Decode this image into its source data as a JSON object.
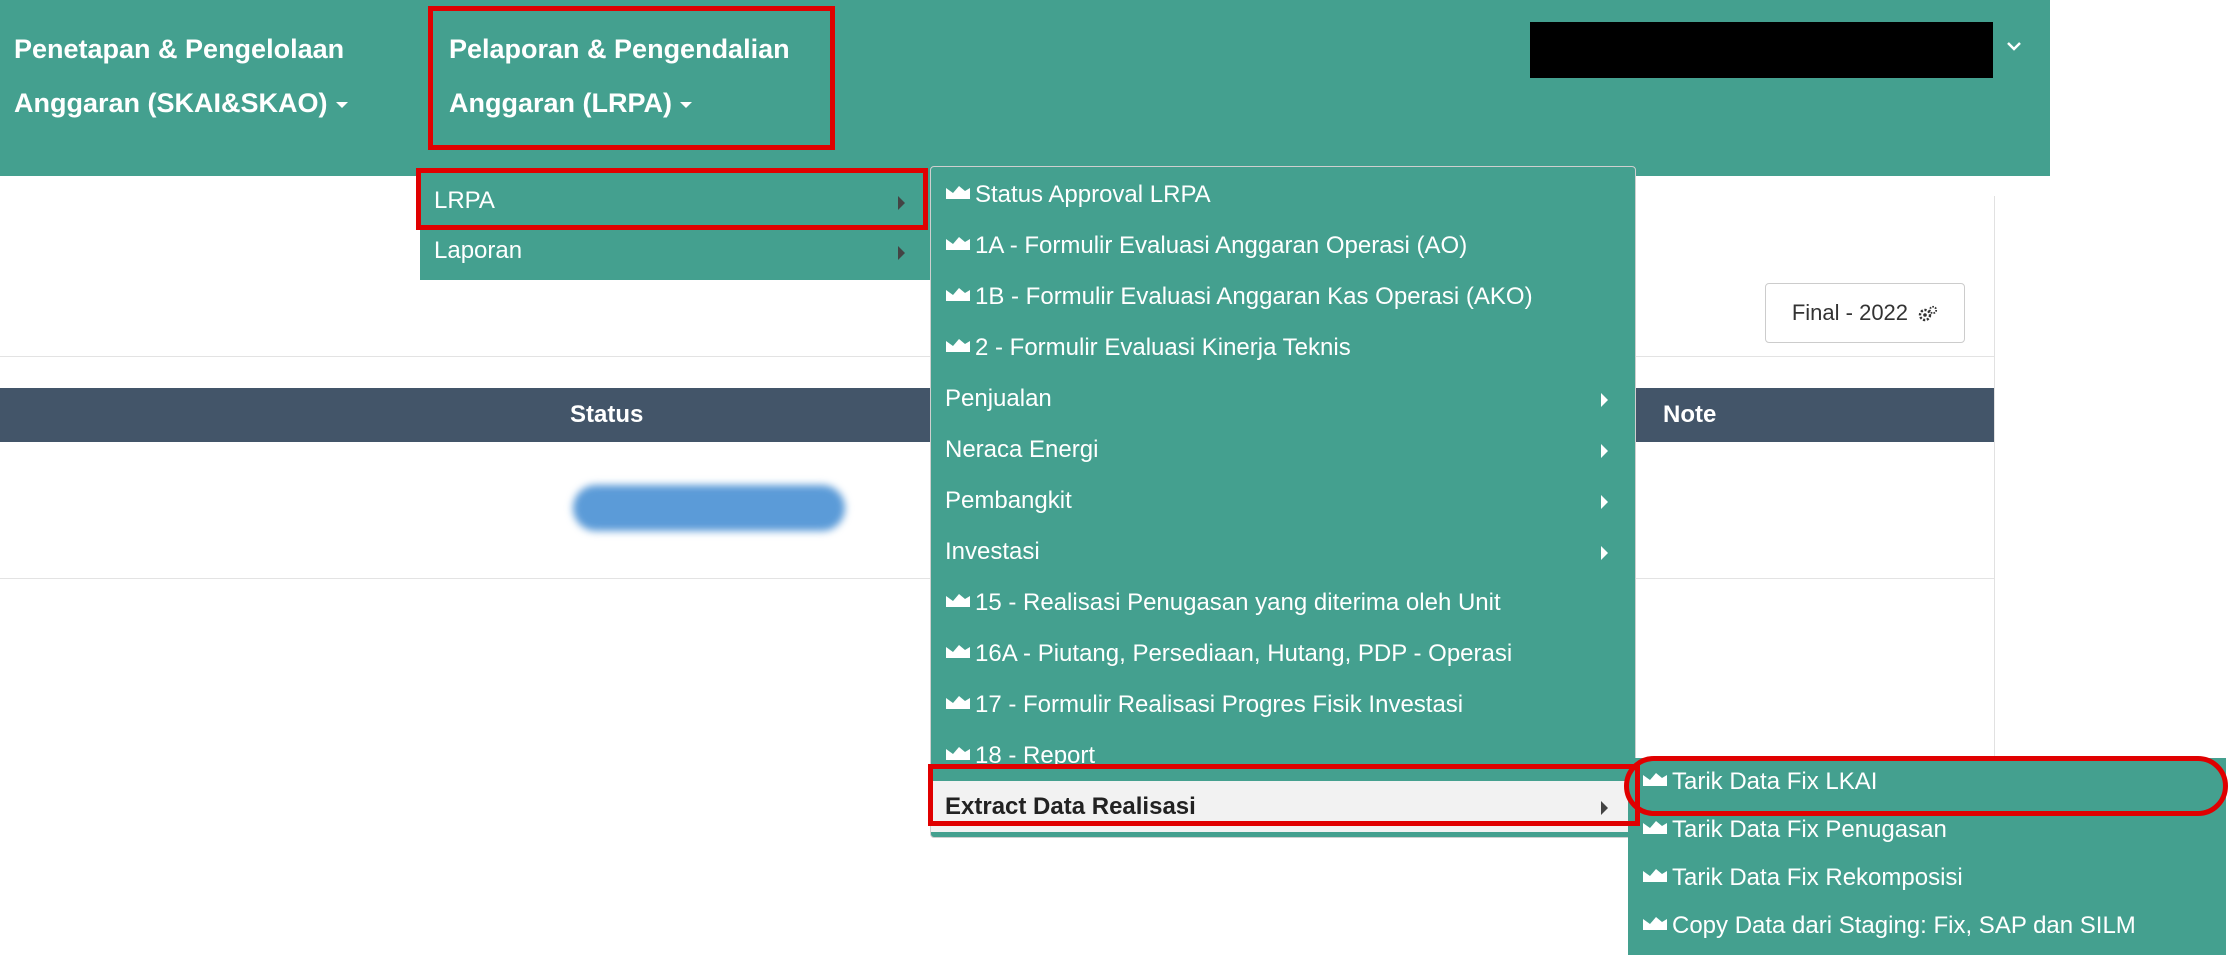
{
  "nav": {
    "menu1": {
      "line1": "Penetapan & Pengelolaan",
      "line2": "Anggaran (SKAI&SKAO)"
    },
    "menu2": {
      "line1": "Pelaporan & Pengendalian",
      "line2": "Anggaran (LRPA)"
    }
  },
  "content": {
    "final_button": "Final - 2022",
    "table_headers": {
      "status": "Status",
      "note": "Note"
    }
  },
  "menu_lrpa": {
    "items": [
      {
        "label": "LRPA"
      },
      {
        "label": "Laporan"
      }
    ]
  },
  "menu_sub": {
    "items": [
      {
        "label": "Status Approval LRPA",
        "icon": "chart-area-icon"
      },
      {
        "label": "1A - Formulir Evaluasi Anggaran Operasi (AO)",
        "icon": "chart-area-icon"
      },
      {
        "label": "1B - Formulir Evaluasi Anggaran Kas Operasi (AKO)",
        "icon": "chart-area-icon"
      },
      {
        "label": "2 - Formulir Evaluasi Kinerja Teknis",
        "icon": "chart-area-icon"
      },
      {
        "label": "Penjualan"
      },
      {
        "label": "Neraca Energi"
      },
      {
        "label": "Pembangkit"
      },
      {
        "label": "Investasi"
      },
      {
        "label": "15 - Realisasi Penugasan yang diterima oleh Unit",
        "icon": "chart-area-icon"
      },
      {
        "label": "16A - Piutang, Persediaan, Hutang, PDP - Operasi",
        "icon": "chart-area-icon"
      },
      {
        "label": "17 - Formulir Realisasi Progres Fisik Investasi",
        "icon": "chart-area-icon"
      },
      {
        "label": "18 - Report",
        "icon": "chart-area-icon"
      },
      {
        "label": "Extract Data Realisasi"
      }
    ]
  },
  "menu_extract": {
    "items": [
      {
        "label": "Tarik Data Fix LKAI",
        "icon": "chart-area-icon"
      },
      {
        "label": "Tarik Data Fix Penugasan",
        "icon": "chart-area-icon"
      },
      {
        "label": "Tarik Data Fix Rekomposisi",
        "icon": "chart-area-icon"
      },
      {
        "label": "Copy Data dari Staging: Fix, SAP dan SILM",
        "icon": "chart-area-icon"
      }
    ]
  },
  "colors": {
    "nav_bg": "#44a08f",
    "table_header_bg": "#435569",
    "highlight": "#e00000",
    "active_item_bg": "#f2f2f2"
  }
}
